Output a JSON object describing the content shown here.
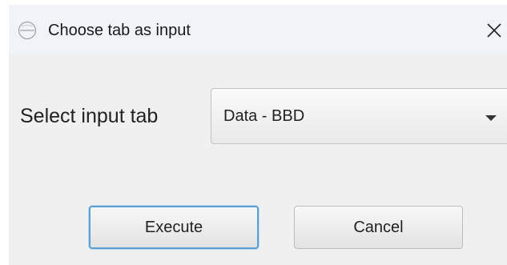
{
  "window": {
    "title": "Choose tab as input",
    "app_icon": "app-logo-icon",
    "close_icon": "close-icon"
  },
  "form": {
    "label": "Select input tab",
    "select": {
      "value": "Data - BBD",
      "icon": "chevron-down-icon"
    }
  },
  "buttons": {
    "execute_label": "Execute",
    "cancel_label": "Cancel"
  },
  "colors": {
    "titlebar": "#f0f4f9",
    "dialog_bg": "#f0f0f0",
    "focus_border": "#5aa0d2"
  }
}
